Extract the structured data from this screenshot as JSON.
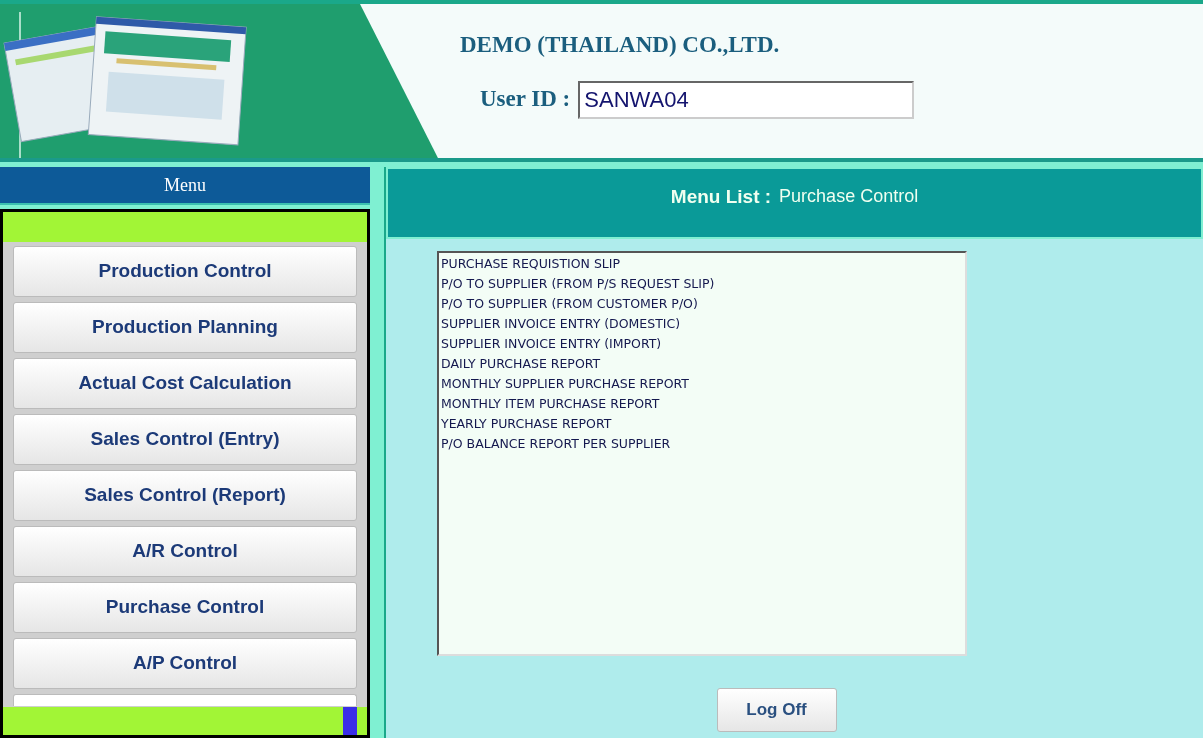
{
  "header": {
    "company": "DEMO (THAILAND) CO.,LTD.",
    "user_id_label": "User ID :",
    "user_id_value": "SANWA04"
  },
  "menu": {
    "title": "Menu",
    "items": [
      {
        "label": "Production Control",
        "kind": "button"
      },
      {
        "label": "Production Planning",
        "kind": "button"
      },
      {
        "label": "Actual Cost Calculation",
        "kind": "button"
      },
      {
        "label": "Sales Control (Entry)",
        "kind": "button"
      },
      {
        "label": "Sales Control (Report)",
        "kind": "button"
      },
      {
        "label": "A/R Control",
        "kind": "button"
      },
      {
        "label": "Purchase Control",
        "kind": "button"
      },
      {
        "label": "A/P Control",
        "kind": "button"
      },
      {
        "kind": "hidden-button"
      }
    ]
  },
  "menu_list": {
    "title_label": "Menu List :",
    "title_value": "Purchase Control",
    "items": [
      "PURCHASE REQUISTION SLIP",
      "P/O TO SUPPLIER (FROM P/S REQUEST SLIP)",
      "P/O TO SUPPLIER (FROM CUSTOMER P/O)",
      "SUPPLIER INVOICE ENTRY (DOMESTIC)",
      "SUPPLIER INVOICE ENTRY (IMPORT)",
      "DAILY PURCHASE REPORT",
      "MONTHLY SUPPLIER PURCHASE REPORT",
      "MONTHLY ITEM PURCHASE REPORT",
      "YEARLY PURCHASE REPORT",
      "P/O BALANCE REPORT PER SUPPLIER"
    ]
  },
  "log_off": "Log Off"
}
